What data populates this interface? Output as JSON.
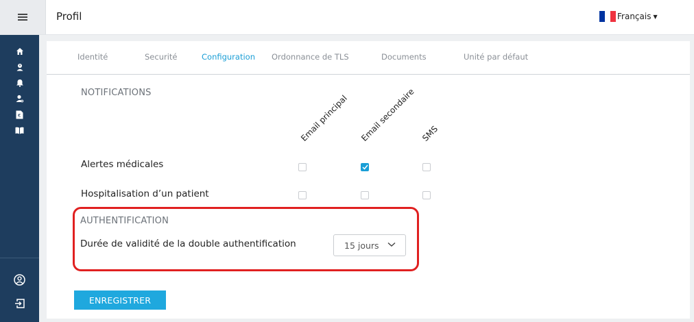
{
  "header": {
    "title": "Profil",
    "language": "Français",
    "flag_colors": [
      "#0033a0",
      "#ffffff",
      "#ef3340"
    ]
  },
  "sidebar": {
    "background": "#1e3d5e",
    "top_items": [
      {
        "icon": "home-icon"
      },
      {
        "icon": "patient-alert-icon"
      },
      {
        "icon": "bell-icon"
      },
      {
        "icon": "user-search-icon"
      },
      {
        "icon": "invoice-euro-icon"
      },
      {
        "icon": "book-icon"
      }
    ],
    "bottom_items": [
      {
        "icon": "account-circle-icon"
      },
      {
        "icon": "logout-icon"
      }
    ]
  },
  "tabs": [
    {
      "label": "Identité",
      "active": false
    },
    {
      "label": "Securité",
      "active": false
    },
    {
      "label": "Configuration",
      "active": true
    },
    {
      "label": "Ordonnance de TLS",
      "active": false
    },
    {
      "label": "Documents",
      "active": false
    },
    {
      "label": "Unité par défaut",
      "active": false
    }
  ],
  "notifications": {
    "title": "NOTIFICATIONS",
    "columns": [
      "Email principal",
      "Email secondaire",
      "SMS"
    ],
    "rows": [
      {
        "label": "Alertes médicales",
        "values": [
          false,
          true,
          false
        ]
      },
      {
        "label": "Hospitalisation d’un patient",
        "values": [
          false,
          false,
          false
        ]
      }
    ]
  },
  "authentication": {
    "title": "AUTHENTIFICATION",
    "validity_label": "Durée de validité de la double authentification",
    "validity_value": "15 jours",
    "highlight_color": "#e02020"
  },
  "actions": {
    "save_label": "ENREGISTRER",
    "accent": "#1fa8de"
  }
}
